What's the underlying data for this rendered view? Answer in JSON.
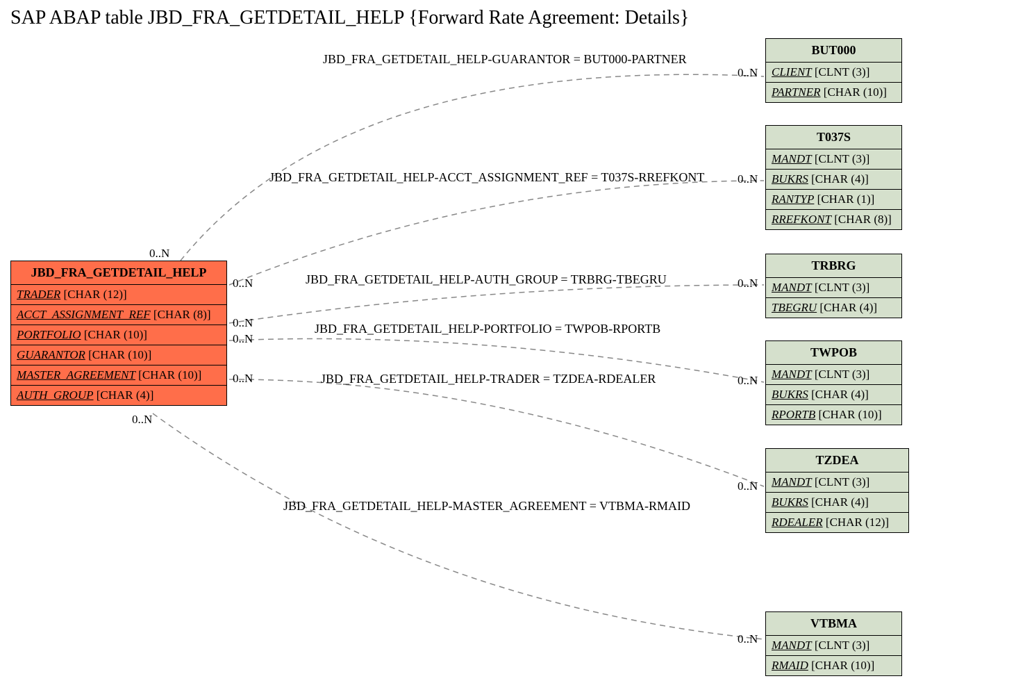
{
  "title": "SAP ABAP table JBD_FRA_GETDETAIL_HELP {Forward Rate Agreement: Details}",
  "mainTable": {
    "name": "JBD_FRA_GETDETAIL_HELP",
    "fields": [
      {
        "name": "TRADER",
        "type": "[CHAR (12)]"
      },
      {
        "name": "ACCT_ASSIGNMENT_REF",
        "type": "[CHAR (8)]"
      },
      {
        "name": "PORTFOLIO",
        "type": "[CHAR (10)]"
      },
      {
        "name": "GUARANTOR",
        "type": "[CHAR (10)]"
      },
      {
        "name": "MASTER_AGREEMENT",
        "type": "[CHAR (10)]"
      },
      {
        "name": "AUTH_GROUP",
        "type": "[CHAR (4)]"
      }
    ]
  },
  "refTables": [
    {
      "name": "BUT000",
      "fields": [
        {
          "name": "CLIENT",
          "type": "[CLNT (3)]"
        },
        {
          "name": "PARTNER",
          "type": "[CHAR (10)]"
        }
      ]
    },
    {
      "name": "T037S",
      "fields": [
        {
          "name": "MANDT",
          "type": "[CLNT (3)]"
        },
        {
          "name": "BUKRS",
          "type": "[CHAR (4)]"
        },
        {
          "name": "RANTYP",
          "type": "[CHAR (1)]"
        },
        {
          "name": "RREFKONT",
          "type": "[CHAR (8)]"
        }
      ]
    },
    {
      "name": "TRBRG",
      "fields": [
        {
          "name": "MANDT",
          "type": "[CLNT (3)]"
        },
        {
          "name": "TBEGRU",
          "type": "[CHAR (4)]"
        }
      ]
    },
    {
      "name": "TWPOB",
      "fields": [
        {
          "name": "MANDT",
          "type": "[CLNT (3)]"
        },
        {
          "name": "BUKRS",
          "type": "[CHAR (4)]"
        },
        {
          "name": "RPORTB",
          "type": "[CHAR (10)]"
        }
      ]
    },
    {
      "name": "TZDEA",
      "fields": [
        {
          "name": "MANDT",
          "type": "[CLNT (3)]"
        },
        {
          "name": "BUKRS",
          "type": "[CHAR (4)]"
        },
        {
          "name": "RDEALER",
          "type": "[CHAR (12)]"
        }
      ]
    },
    {
      "name": "VTBMA",
      "fields": [
        {
          "name": "MANDT",
          "type": "[CLNT (3)]"
        },
        {
          "name": "RMAID",
          "type": "[CHAR (10)]"
        }
      ]
    }
  ],
  "edges": [
    {
      "label": "JBD_FRA_GETDETAIL_HELP-GUARANTOR = BUT000-PARTNER",
      "leftCard": "0..N",
      "rightCard": "0..N"
    },
    {
      "label": "JBD_FRA_GETDETAIL_HELP-ACCT_ASSIGNMENT_REF = T037S-RREFKONT",
      "leftCard": "0..N",
      "rightCard": "0..N"
    },
    {
      "label": "JBD_FRA_GETDETAIL_HELP-AUTH_GROUP = TRBRG-TBEGRU",
      "leftCard": "0..N",
      "rightCard": "0..N"
    },
    {
      "label": "JBD_FRA_GETDETAIL_HELP-PORTFOLIO = TWPOB-RPORTB",
      "leftCard": "0..N",
      "rightCard": "0..N"
    },
    {
      "label": "JBD_FRA_GETDETAIL_HELP-TRADER = TZDEA-RDEALER",
      "leftCard": "0..N",
      "rightCard": "0..N"
    },
    {
      "label": "JBD_FRA_GETDETAIL_HELP-MASTER_AGREEMENT = VTBMA-RMAID",
      "leftCard": "0..N",
      "rightCard": "0..N"
    }
  ]
}
